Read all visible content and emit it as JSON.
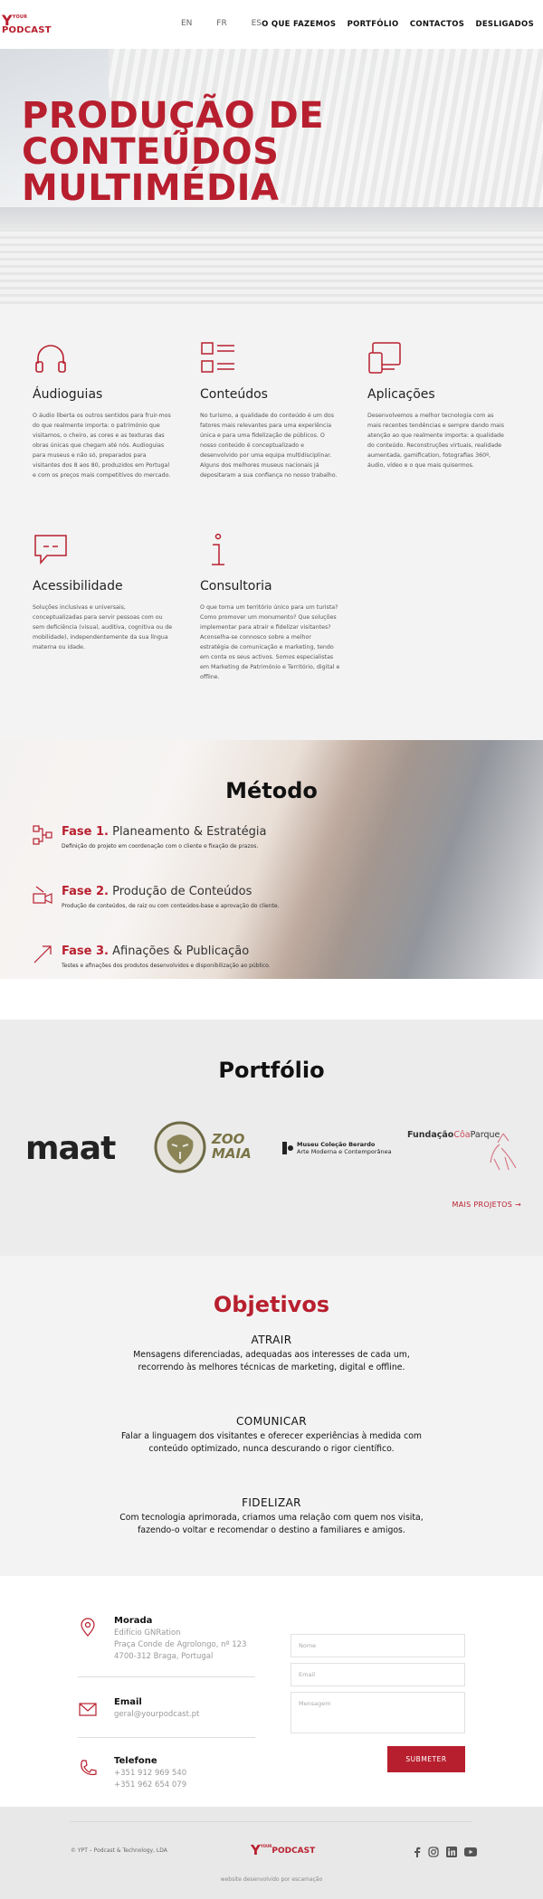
{
  "header": {
    "logo_small": "YOUR",
    "logo_main": "PODCAST",
    "languages": [
      "EN",
      "FR",
      "ES"
    ],
    "nav": [
      "O QUE FAZEMOS",
      "PORTFÓLIO",
      "CONTACTOS",
      "DESLIGADOS"
    ]
  },
  "hero": {
    "title_lines": [
      "PRODUÇÃO DE",
      "CONTEÚDOS",
      "MULTIMÉDIA"
    ],
    "slides": 4,
    "active_slide": 2
  },
  "services": [
    {
      "icon": "headphones-icon",
      "title": "Áudioguias",
      "text": "O áudio liberta os outros sentidos para fruir-mos do que realmente importa: o património que visitamos, o cheiro, as cores e as texturas das obras únicas que chegam até nós. Audioguias para museus e não só, preparados para visitantes dos 8 aos 80, produzidos em Portugal e com os preços mais competitivos do mercado."
    },
    {
      "icon": "content-grid-icon",
      "title": "Conteúdos",
      "text": "No turismo, a qualidade do conteúdo é um dos fatores mais relevantes para uma experiência única e para uma fidelização de públicos. O nosso conteúdo é conceptualizado e desenvolvido por uma equipa multidisciplinar. Alguns dos melhores museus nacionais já depositaram a sua confiança no nosso trabalho."
    },
    {
      "icon": "devices-icon",
      "title": "Aplicações",
      "text": "Desenvolvemos a melhor tecnologia com as mais recentes tendências e sempre dando mais atenção ao que realmente importa: a qualidade do conteúdo. Reconstruções virtuais, realidade aumentada, gamification, fotografias 360º, áudio, vídeo e o que mais quisermos."
    },
    {
      "icon": "speech-bubble-icon",
      "title": "Acessibilidade",
      "text": "Soluções inclusivas e universais, conceptualizadas para servir pessoas com ou sem deficiência (visual, auditiva, cognitiva ou de mobilidade), independentemente da sua língua materna ou idade."
    },
    {
      "icon": "info-icon",
      "title": "Consultoria",
      "text": "O que torna um território único para um turista? Como promover um monumento? Que soluções implementar para atrair e fidelizar visitantes? Aconselha-se connosco sobre a melhor estratégia de comunicação e marketing, tendo em conta os seus activos. Somos especialistas em Marketing de Património e Território, digital e offline."
    }
  ],
  "method": {
    "title": "Método",
    "phases": [
      {
        "num": "Fase 1.",
        "name": "Planeamento & Estratégia",
        "desc": "Definição do projeto em coordenação com o cliente e fixação de prazos."
      },
      {
        "num": "Fase 2.",
        "name": "Produção de Conteúdos",
        "desc": "Produção de conteúdos, de raiz ou com conteúdos-base e aprovação do cliente."
      },
      {
        "num": "Fase 3.",
        "name": "Afinações & Publicação",
        "desc": "Testes e afinações dos produtos desenvolvidos e disponibilização ao público."
      }
    ]
  },
  "portfolio": {
    "title": "Portfólio",
    "logos": {
      "maat": "maat",
      "zoo_line1": "ZOO",
      "zoo_line2": "MAIA",
      "berardo_line1": "Museu Coleção Berardo",
      "berardo_line2": "Arte Moderna e Contemporânea",
      "coa_a": "Fundação",
      "coa_b": "Côa",
      "coa_c": "Parque"
    },
    "more": "MAIS PROJETOS →"
  },
  "objectives": {
    "title": "Objetivos",
    "items": [
      {
        "title": "ATRAIR",
        "text": "Mensagens diferenciadas, adequadas aos interesses de cada um, recorrendo às melhores técnicas de marketing, digital e offline."
      },
      {
        "title": "COMUNICAR",
        "text": "Falar a linguagem dos visitantes e oferecer experiências à medida com conteúdo optimizado, nunca descurando o rigor científico."
      },
      {
        "title": "FIDELIZAR",
        "text": "Com tecnologia aprimorada, criamos uma relação com quem nos visita, fazendo-o voltar e recomendar o destino a familiares e amigos."
      }
    ]
  },
  "contact": {
    "address_label": "Morada",
    "address_lines": [
      "Edifício GNRation",
      "Praça Conde de Agrolongo, nº 123",
      "4700-312 Braga, Portugal"
    ],
    "email_label": "Email",
    "email": "geral@yourpodcast.pt",
    "phone_label": "Telefone",
    "phones": [
      "+351 912 969 540",
      "+351 962 654 079"
    ],
    "form": {
      "name_placeholder": "Nome",
      "email_placeholder": "Email",
      "message_placeholder": "Mensagem",
      "submit": "SUBMETER"
    }
  },
  "footer": {
    "copyright": "© YPT – Podcast & Technology, LDA",
    "logo_small": "YOUR",
    "logo_main": "PODCAST",
    "social": [
      "facebook-icon",
      "instagram-icon",
      "linkedin-icon",
      "youtube-icon"
    ],
    "credit": "website desenvolvido por escamação"
  },
  "colors": {
    "accent": "#b81f2e",
    "section_bg": "#f3f3f3",
    "footer_bg": "#e8e8e8"
  }
}
